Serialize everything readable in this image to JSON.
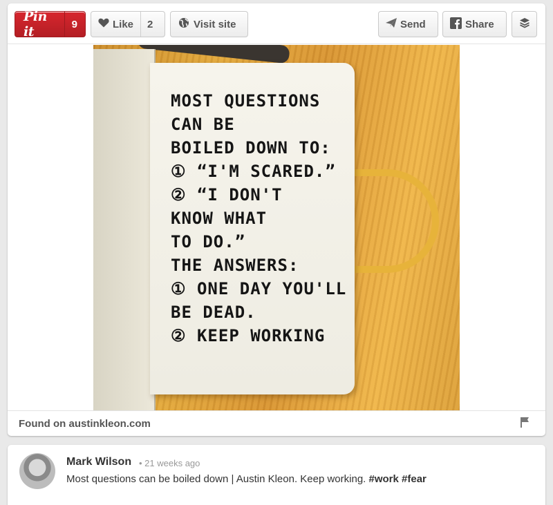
{
  "toolbar": {
    "pinit_label": "Pin it",
    "pinit_count": "9",
    "like_label": "Like",
    "like_count": "2",
    "visit_label": "Visit site",
    "send_label": "Send",
    "share_label": "Share"
  },
  "photo": {
    "note_lines": [
      "MOST QUESTIONS",
      "      CAN BE",
      "BOILED DOWN TO:",
      "① “I'M SCARED.”",
      "② “I DON'T",
      "  KNOW WHAT",
      "  TO DO.”",
      "THE ANSWERS:",
      "① ONE DAY YOU'LL",
      "  BE DEAD.",
      "② KEEP WORKING"
    ]
  },
  "source": {
    "found_label": "Found on austinkleon.com"
  },
  "comment": {
    "author": "Mark Wilson",
    "meta": "• 21 weeks ago",
    "text": "Most questions can be boiled down | Austin Kleon. Keep working. ",
    "tags": "#work #fear"
  },
  "colors": {
    "pinit_red": "#cb2027",
    "background": "#e9e9e9"
  }
}
